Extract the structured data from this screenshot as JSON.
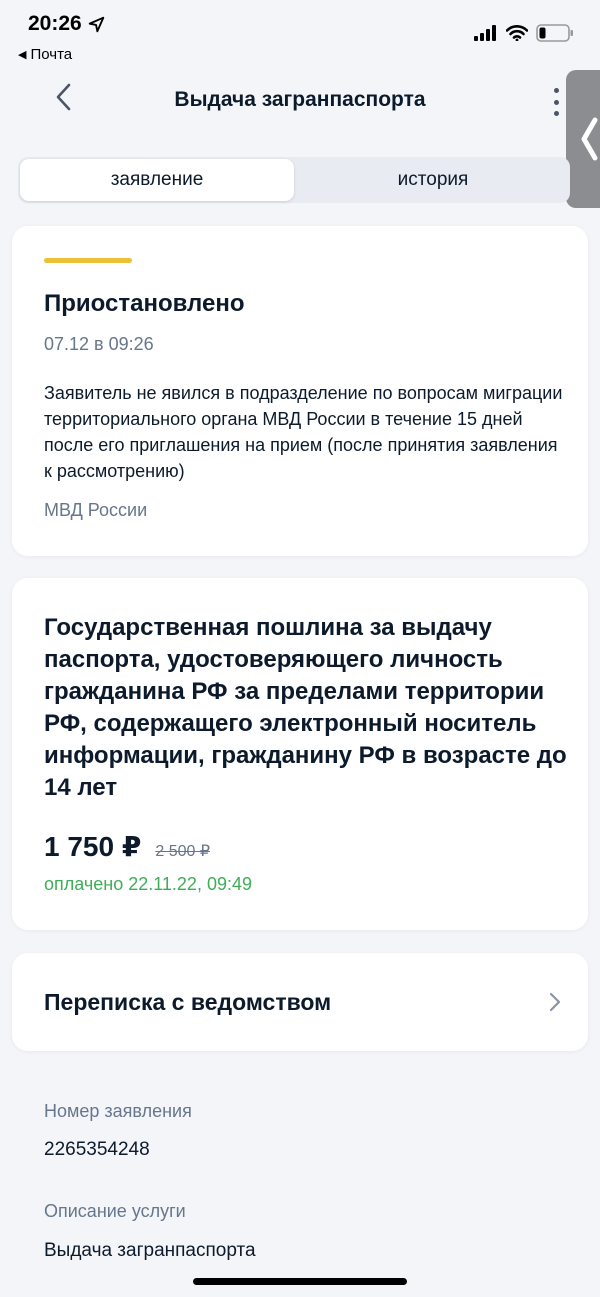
{
  "status_bar": {
    "time": "20:26",
    "back_app": "Почта",
    "icons": [
      "location-arrow-icon",
      "signal-icon",
      "wifi-icon",
      "battery-icon"
    ]
  },
  "header": {
    "title": "Выдача загранпаспорта",
    "back_icon": "chevron-left-icon",
    "menu_icon": "kebab-icon"
  },
  "tabs": [
    {
      "label": "заявление",
      "active": true
    },
    {
      "label": "история",
      "active": false
    }
  ],
  "status_card": {
    "accent_color": "#ecc137",
    "title": "Приостановлено",
    "date": "07.12 в 09:26",
    "text": "Заявитель не явился в подразделение по вопросам миграции территориального органа МВД России в течение 15 дней после его приглашения на прием (после принятия заявления к рассмотрению)",
    "org": "МВД России"
  },
  "fee_card": {
    "title": "Государственная пошлина за выдачу паспорта, удостоверяющего личность гражданина РФ за пределами территории РФ, содержащего электронный носитель информации, гражданину РФ в возрасте до 14 лет",
    "price": "1 750 ₽",
    "old_price": "2 500 ₽",
    "paid": "оплачено 22.11.22, 09:49",
    "paid_color": "#3fae57"
  },
  "correspondence": {
    "label": "Переписка с ведомством",
    "icon": "chevron-right-icon"
  },
  "info": {
    "number_label": "Номер заявления",
    "number_value": "2265354248",
    "description_label": "Описание услуги",
    "description_value": "Выдача загранпаспорта"
  }
}
